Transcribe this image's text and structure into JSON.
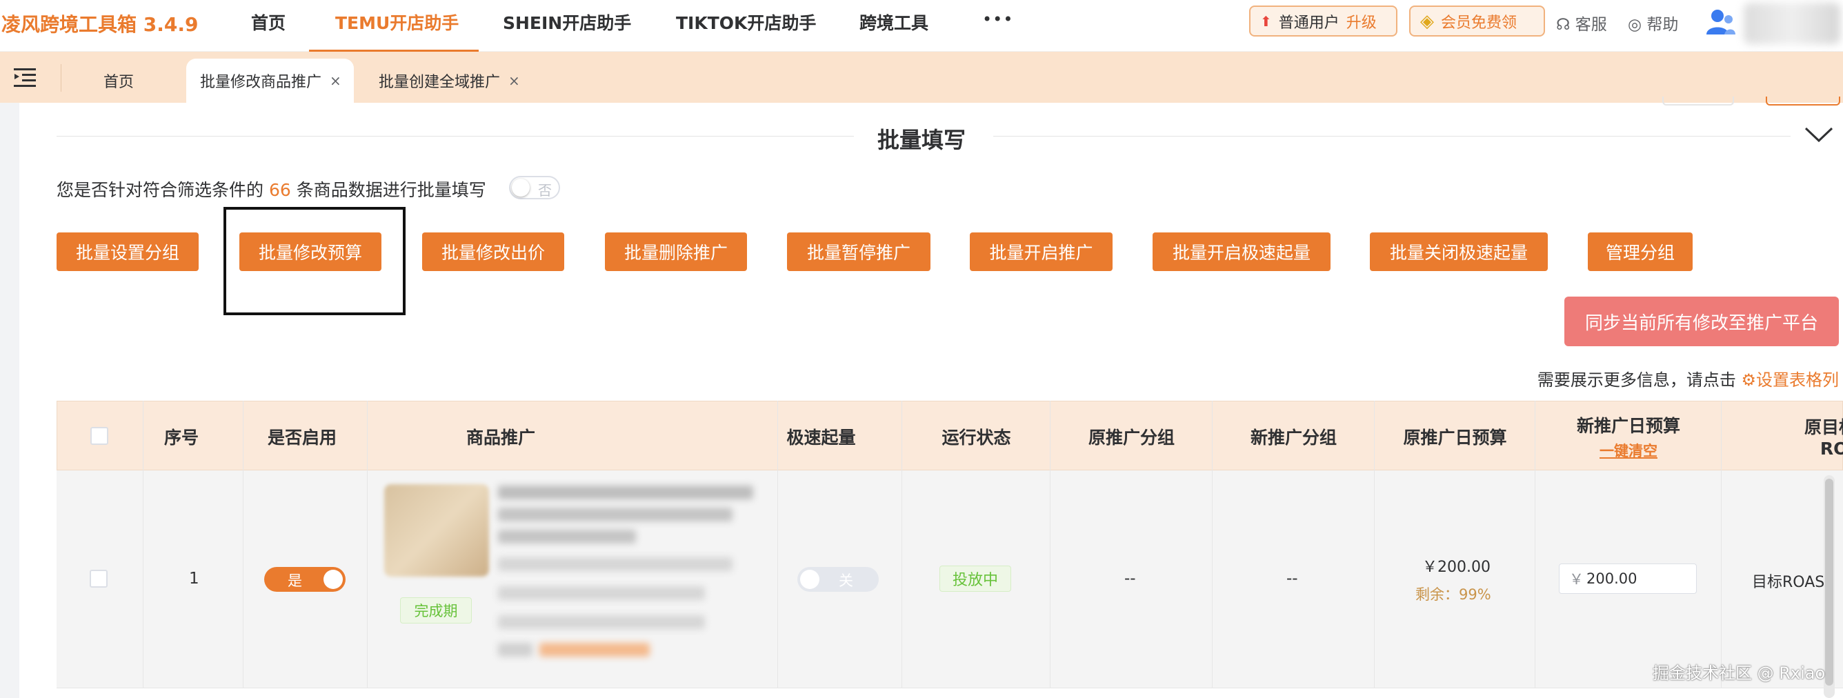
{
  "app": {
    "brand": "凌风跨境工具箱 3.4.9"
  },
  "nav": {
    "items": [
      "首页",
      "TEMU开店助手",
      "SHEIN开店助手",
      "TIKTOK开店助手",
      "跨境工具"
    ],
    "active_index": 1,
    "more": "•••"
  },
  "header_right": {
    "user_level": "普通用户",
    "upgrade": "升级",
    "vip": "会员免费领",
    "service": "客服",
    "help": "帮助"
  },
  "tabs": [
    {
      "label": "首页"
    },
    {
      "label": "批量修改商品推广",
      "closable": "×"
    },
    {
      "label": "批量创建全域推广",
      "closable": "×"
    }
  ],
  "batch": {
    "section_title": "批量填写",
    "question_prefix": "您是否针对符合筛选条件的",
    "count": "66",
    "question_suffix": "条商品数据进行批量填写",
    "toggle_label": "否",
    "buttons": [
      "批量设置分组",
      "批量修改预算",
      "批量修改出价",
      "批量删除推广",
      "批量暂停推广",
      "批量开启推广",
      "批量开启极速起量",
      "批量关闭极速起量",
      "管理分组"
    ],
    "sync_button": "同步当前所有修改至推广平台",
    "hint_text": "需要展示更多信息，请点击",
    "hint_link": "设置表格列"
  },
  "table": {
    "headers": {
      "index": "序号",
      "enabled": "是否启用",
      "product": "商品推广",
      "speed": "极速起量",
      "status": "运行状态",
      "old_group": "原推广分组",
      "new_group": "新推广分组",
      "old_budget": "原推广日预算",
      "new_budget": "新推广日预算",
      "clear_all": "一键清空",
      "target_roas_line1": "原目标全",
      "target_roas_line2": "ROAS"
    },
    "rows": [
      {
        "index": "1",
        "enabled": "是",
        "product_tag": "完成期",
        "speed": "关",
        "status": "投放中",
        "old_group": "--",
        "new_group": "--",
        "old_budget": "￥200.00",
        "remaining": "剩余：99%",
        "currency": "￥",
        "new_budget_value": "200.00",
        "target_roas": "目标ROAS："
      }
    ]
  },
  "watermark": "掘金技术社区 @ Rxiao",
  "colors": {
    "accent": "#ea7b2e",
    "sync": "#ee7b78",
    "tab_bar": "#fbe3cd",
    "success": "#67c23a"
  }
}
